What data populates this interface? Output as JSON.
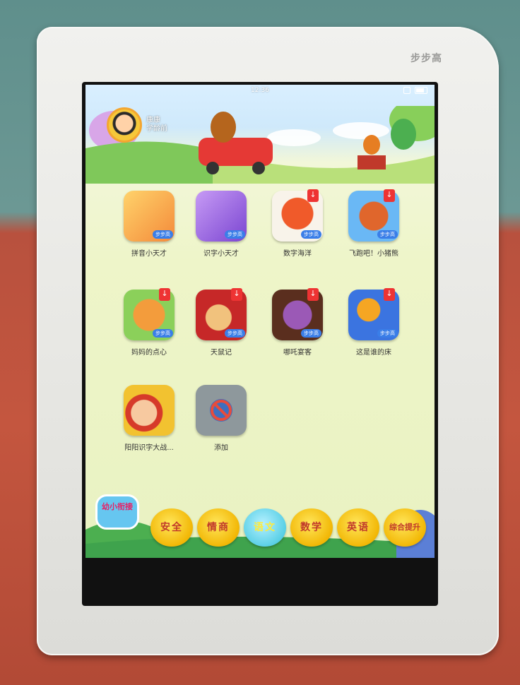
{
  "device": {
    "brand": "步步高"
  },
  "status_bar": {
    "time": "12:36"
  },
  "profile": {
    "name": "康康",
    "subtitle": "学龄前"
  },
  "apps": [
    {
      "label": "拼音小天才",
      "icon": "pinyin-icon",
      "color": "#f4a84a",
      "downloadable": false
    },
    {
      "label": "识字小天才",
      "icon": "shizi-icon",
      "color": "#a86fe0",
      "downloadable": false
    },
    {
      "label": "数字海洋",
      "icon": "crab-icon",
      "color": "#f5f0e8",
      "downloadable": true
    },
    {
      "label": "飞跑吧！小猪熊",
      "icon": "raccoon-icon",
      "color": "#4da3f0",
      "downloadable": true
    },
    {
      "label": "妈妈的点心",
      "icon": "pizza-icon",
      "color": "#7cc84a",
      "downloadable": true
    },
    {
      "label": "天鼠记",
      "icon": "lion-icon",
      "color": "#c0392b",
      "downloadable": true
    },
    {
      "label": "哪吒宴客",
      "icon": "grapes-icon",
      "color": "#6b3b2a",
      "downloadable": true
    },
    {
      "label": "这是谁的床",
      "icon": "bed-icon",
      "color": "#3f7be0",
      "downloadable": true
    },
    {
      "label": "阳阳识字大战...",
      "icon": "yangyang-icon",
      "color": "#f2c230",
      "downloadable": false
    },
    {
      "label": "添加",
      "icon": "add-icon",
      "color": "#7f8c8d",
      "downloadable": false
    }
  ],
  "app_tag_label": "步步高",
  "logo_text": "幼小衔接",
  "tabs": [
    {
      "label": "安全",
      "active": false
    },
    {
      "label": "情商",
      "active": false
    },
    {
      "label": "语文",
      "active": true
    },
    {
      "label": "数学",
      "active": false
    },
    {
      "label": "英语",
      "active": false
    },
    {
      "label": "综合提升",
      "active": false
    }
  ],
  "colors": {
    "tab_yellow": "#f2b705",
    "tab_text": "#c0392b",
    "active_tab": "#5ad0e6"
  }
}
